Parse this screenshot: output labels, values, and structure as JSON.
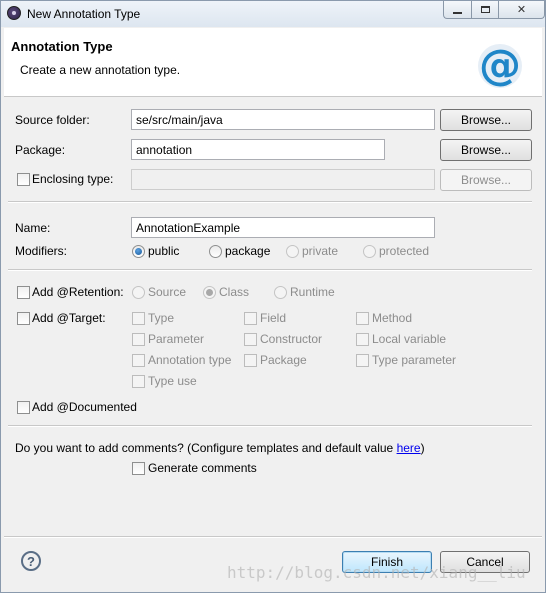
{
  "window": {
    "title": "New Annotation Type",
    "icon": "eclipse-icon",
    "controls": [
      "minimize-icon",
      "maximize-icon",
      "close-icon"
    ],
    "close_glyph": "✕"
  },
  "header": {
    "title": "Annotation Type",
    "description": "Create a new annotation type.",
    "icon": "at-sign-icon",
    "icon_glyph": "@"
  },
  "form": {
    "source_folder": {
      "label": "Source folder:",
      "value": "se/src/main/java",
      "button": "Browse..."
    },
    "package": {
      "label": "Package:",
      "value": "annotation",
      "button": "Browse..."
    },
    "enclosing_type": {
      "label": "Enclosing type:",
      "value": "",
      "button": "Browse...",
      "checked": false
    },
    "name": {
      "label": "Name:",
      "value": "AnnotationExample"
    },
    "modifiers": {
      "label": "Modifiers:",
      "options": [
        "public",
        "package",
        "private",
        "protected"
      ],
      "selected": "public"
    }
  },
  "retention": {
    "label": "Add @Retention:",
    "checked": false,
    "options": [
      "Source",
      "Class",
      "Runtime"
    ],
    "selected": "Class"
  },
  "target": {
    "label": "Add @Target:",
    "checked": false,
    "options": [
      "Type",
      "Field",
      "Method",
      "Parameter",
      "Constructor",
      "Local variable",
      "Annotation type",
      "Package",
      "Type parameter",
      "Type use"
    ]
  },
  "documented": {
    "label": "Add @Documented",
    "checked": false
  },
  "comments": {
    "question": "Do you want to add comments? (Configure templates and default value ",
    "link": "here",
    "close": ")",
    "generate_label": "Generate comments",
    "generate_checked": false
  },
  "footer": {
    "help_icon": "help-icon",
    "help_glyph": "?",
    "finish": "Finish",
    "cancel": "Cancel"
  },
  "watermark": "http://blog.csdn.net/xiang__liu"
}
